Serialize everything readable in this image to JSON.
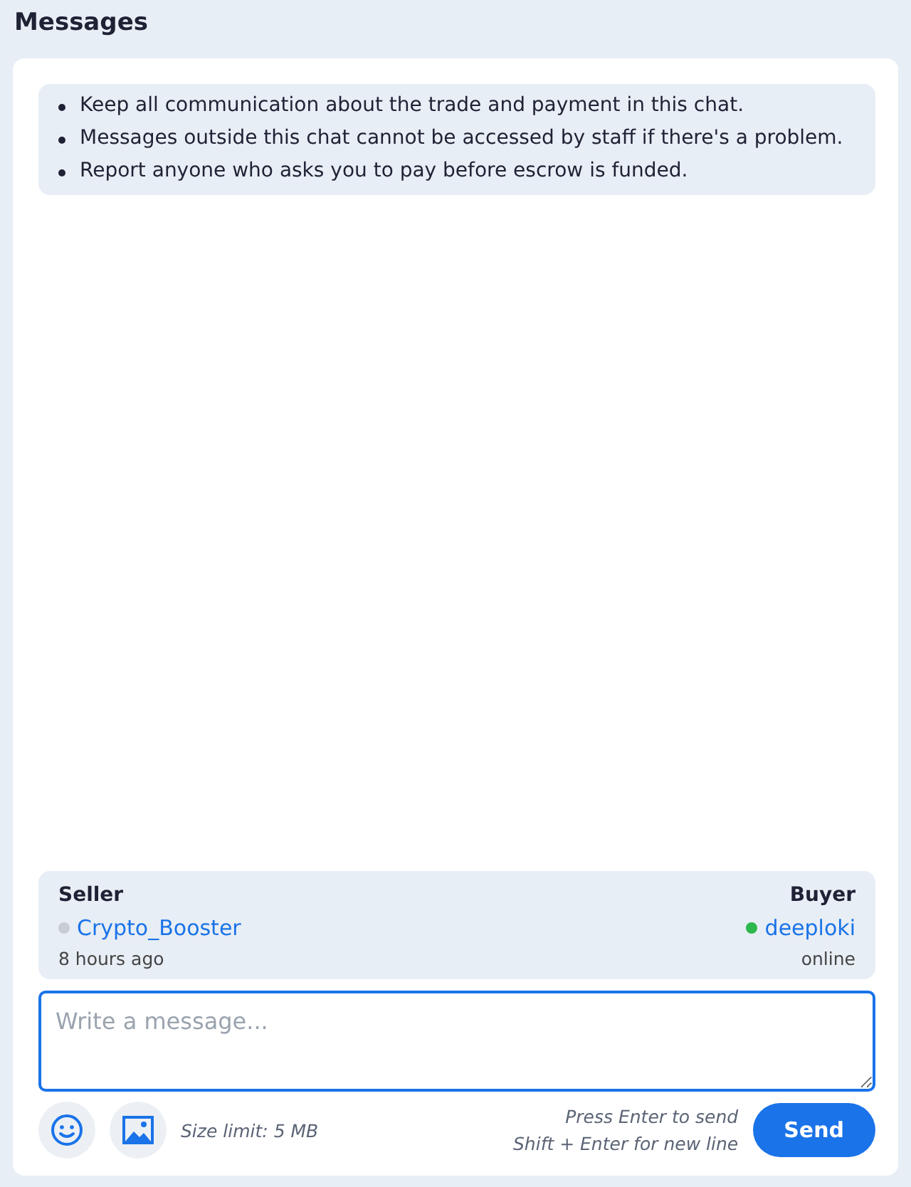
{
  "title": "Messages",
  "rules": [
    "Keep all communication about the trade and payment in this chat.",
    "Messages outside this chat cannot be accessed by staff if there's a problem.",
    "Report anyone who asks you to pay before escrow is funded."
  ],
  "participants": [
    {
      "role": "Seller",
      "name": "Crypto_Booster",
      "online": false,
      "status": "8 hours ago"
    },
    {
      "role": "Buyer",
      "name": "deeploki",
      "online": true,
      "status": "online"
    }
  ],
  "composer": {
    "placeholder": "Write a message...",
    "size_limit": "Size limit: 5 MB",
    "hints": [
      "Press Enter to send",
      "Shift + Enter for new line"
    ],
    "send": "Send"
  }
}
